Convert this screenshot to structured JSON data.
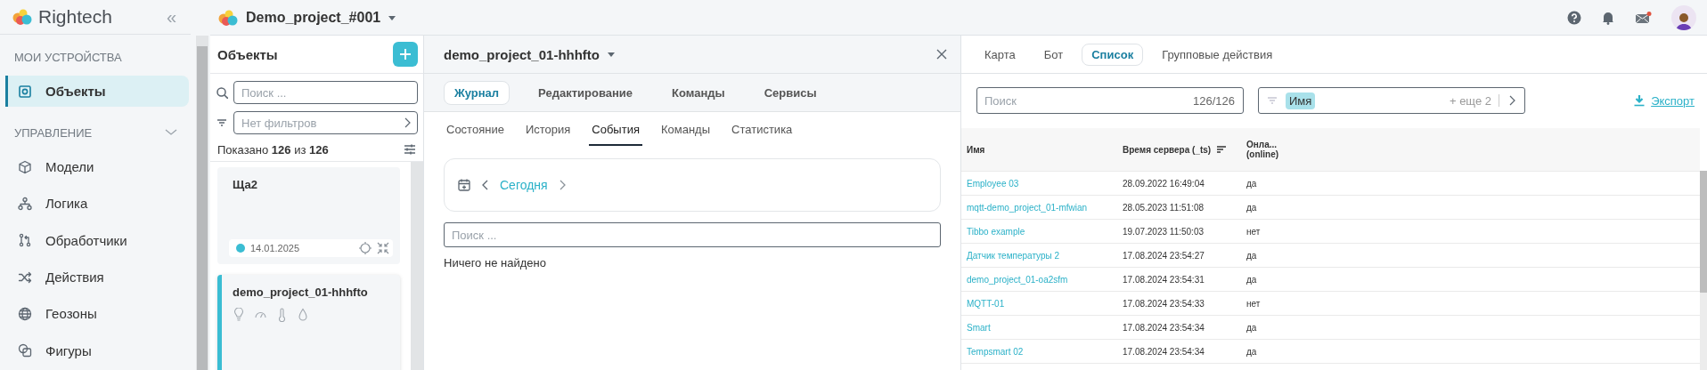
{
  "sidebar": {
    "brand": "Rightech",
    "collapse": "«",
    "sections": [
      {
        "title": "МОИ УСТРОЙСТВА",
        "kind": "plain",
        "items": [
          {
            "label": "Объекты",
            "selected": true
          }
        ]
      },
      {
        "title": "УПРАВЛЕНИЕ",
        "kind": "collapsible",
        "items": [
          {
            "label": "Модели",
            "selected": false
          },
          {
            "label": "Логика",
            "selected": false
          },
          {
            "label": "Обработчики",
            "selected": false
          },
          {
            "label": "Действия",
            "selected": false
          },
          {
            "label": "Геозоны",
            "selected": false
          },
          {
            "label": "Фигуры",
            "selected": false
          }
        ]
      }
    ]
  },
  "topbar": {
    "project": "Demo_project_#001"
  },
  "objects": {
    "title": "Объекты",
    "search": {
      "placeholder": "Поиск ..."
    },
    "filter": {
      "placeholder": "Нет фильтров"
    },
    "count": "Показано **126** из **126**",
    "cards": [
      {
        "kind": "status",
        "name": "Ща2",
        "date": "14.01.2025",
        "color": "#3bbdd3",
        "selected": false
      },
      {
        "kind": "sensors",
        "name": "demo_project_01-hhhfto",
        "selected": true
      }
    ]
  },
  "detail": {
    "title": "demo_project_01-hhhfto",
    "tabs": [
      {
        "label": "Журнал",
        "selected": true
      },
      {
        "label": "Редактирование",
        "selected": false
      },
      {
        "label": "Команды",
        "selected": false
      },
      {
        "label": "Сервисы",
        "selected": false
      }
    ],
    "subtabs": [
      {
        "label": "Состояние",
        "selected": false
      },
      {
        "label": "История",
        "selected": false
      },
      {
        "label": "События",
        "selected": true
      },
      {
        "label": "Команды",
        "selected": false
      },
      {
        "label": "Статистика",
        "selected": false
      }
    ],
    "date_nav": {
      "label": "Сегодня"
    },
    "search": {
      "placeholder": "Поиск ..."
    },
    "empty_message": "Ничего не найдено"
  },
  "list": {
    "tabs": [
      {
        "label": "Карта",
        "selected": false
      },
      {
        "label": "Бот",
        "selected": false
      },
      {
        "label": "Список",
        "selected": true
      },
      {
        "label": "Групповые действия",
        "selected": false
      }
    ],
    "search": {
      "placeholder": "Поиск",
      "count": "126/126"
    },
    "filter": {
      "chip": "Имя",
      "more": "+ еще 2"
    },
    "export": "Экспорт",
    "table": {
      "columns": [
        {
          "label": "Имя",
          "sorted": false
        },
        {
          "label": "Время сервера (_ts)",
          "sorted": true
        },
        {
          "label": "Онла...",
          "sublabel": "(online)",
          "sorted": false
        }
      ],
      "rows": [
        {
          "name": "Employee 03",
          "time": "28.09.2022 16:49:04",
          "online": "да"
        },
        {
          "name": "mqtt-demo_project_01-mfwian",
          "time": "28.05.2023 11:51:08",
          "online": "да"
        },
        {
          "name": "Tibbo example",
          "time": "19.07.2023 11:50:03",
          "online": "нет"
        },
        {
          "name": "Датчик температуры 2",
          "time": "17.08.2024 23:54:27",
          "online": "да"
        },
        {
          "name": "demo_project_01-oa2sfm",
          "time": "17.08.2024 23:54:31",
          "online": "да"
        },
        {
          "name": "MQTT-01",
          "time": "17.08.2024 23:54:33",
          "online": "нет"
        },
        {
          "name": "Smart",
          "time": "17.08.2024 23:54:34",
          "online": "да"
        },
        {
          "name": "Tempsmart 02",
          "time": "17.08.2024 23:54:34",
          "online": "да"
        }
      ]
    }
  }
}
